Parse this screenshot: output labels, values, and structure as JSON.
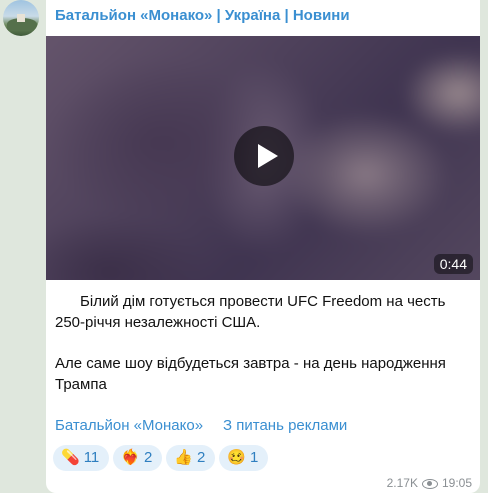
{
  "channel": {
    "title": "Батальйон «Монако» | Україна | Новини"
  },
  "video": {
    "duration": "0:44"
  },
  "message": {
    "line1": "      Білий дім готується провести UFC Freedom на честь 250-річчя незалежності США.",
    "line2": "Але саме шоу відбудеться завтра - на день народження Трампа"
  },
  "links": {
    "channel": "Батальйон «Монако»",
    "ads": "З питань реклами"
  },
  "reactions": [
    {
      "emoji": "💊",
      "count": "11"
    },
    {
      "emoji": "❤️‍🔥",
      "count": "2"
    },
    {
      "emoji": "👍",
      "count": "2"
    },
    {
      "emoji": "🥴",
      "count": "1"
    }
  ],
  "meta": {
    "views": "2.17K",
    "time": "19:05"
  }
}
